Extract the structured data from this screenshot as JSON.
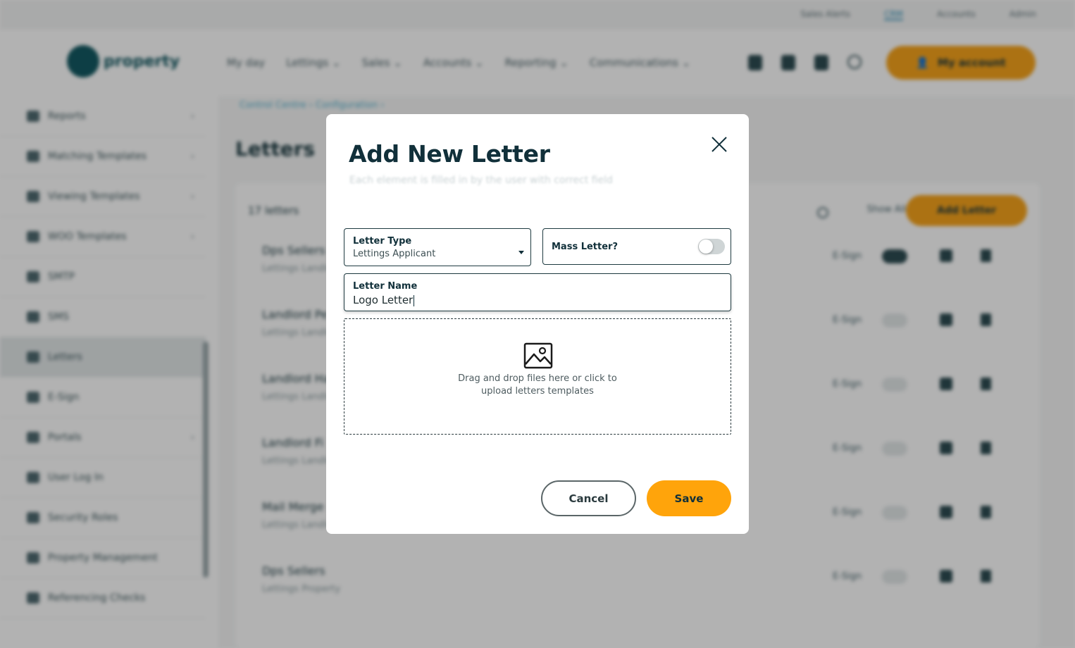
{
  "background": {
    "top_links": [
      "Sales Alerts",
      "CRM",
      "Accounts",
      "Admin"
    ],
    "brand": "property",
    "nav": [
      "My day",
      "Lettings",
      "Sales",
      "Accounts",
      "Reporting",
      "Communications"
    ],
    "account_label": "My account",
    "sidebar": [
      {
        "label": "Reports",
        "chevron": "›"
      },
      {
        "label": "Matching Templates",
        "chevron": "›"
      },
      {
        "label": "Viewing Templates",
        "chevron": "›"
      },
      {
        "label": "WOO Templates",
        "chevron": "›"
      },
      {
        "label": "SMTP",
        "chevron": ""
      },
      {
        "label": "SMS",
        "chevron": ""
      },
      {
        "label": "Letters",
        "chevron": ""
      },
      {
        "label": "E-Sign",
        "chevron": ""
      },
      {
        "label": "Portals",
        "chevron": "›"
      },
      {
        "label": "User Log In",
        "chevron": ""
      },
      {
        "label": "Security Roles",
        "chevron": ""
      },
      {
        "label": "Property Management",
        "chevron": ""
      },
      {
        "label": "Referencing Checks",
        "chevron": ""
      }
    ],
    "breadcrumb": "Control Centre  ›  Configuration  ›",
    "page_title": "Letters",
    "count_label": "17 letters",
    "show_label": "Show All",
    "add_label": "Add Letter",
    "rows": [
      {
        "title": "Dps Sellers",
        "sub": "Lettings Landlord",
        "status": "E-Sign"
      },
      {
        "title": "Landlord Pe",
        "sub": "Lettings Landlord",
        "status": "E-Sign"
      },
      {
        "title": "Landlord Ha",
        "sub": "Lettings Landlord",
        "status": "E-Sign"
      },
      {
        "title": "Landlord Fi",
        "sub": "Lettings Landlord",
        "status": "E-Sign"
      },
      {
        "title": "Mail Merge",
        "sub": "Lettings Landlord",
        "status": "E-Sign"
      },
      {
        "title": "Dps Sellers",
        "sub": "Lettings Property",
        "status": "E-Sign"
      }
    ]
  },
  "modal": {
    "title": "Add New Letter",
    "subtitle": "Each element is filled in by the user with correct field",
    "letter_type": {
      "label": "Letter Type",
      "value": "Lettings Applicant"
    },
    "mass_letter": {
      "label": "Mass Letter?",
      "enabled": false
    },
    "letter_name": {
      "label": "Letter Name",
      "value": "Logo Letter"
    },
    "dropzone": {
      "line1": "Drag and drop files here or click to",
      "line2": "upload letters templates"
    },
    "cancel_label": "Cancel",
    "save_label": "Save"
  },
  "colors": {
    "accent": "#ffa40b",
    "primary_text": "#11303a",
    "overlay": "rgba(0,0,0,0.30)"
  }
}
